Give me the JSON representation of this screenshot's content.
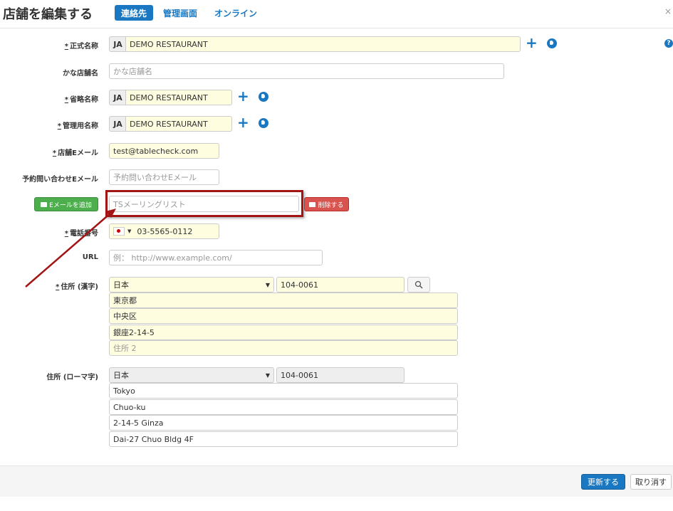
{
  "header": {
    "title": "店舗を編集する",
    "tabs": [
      {
        "label": "連絡先",
        "active": true
      },
      {
        "label": "管理画面",
        "active": false
      },
      {
        "label": "オンライン",
        "active": false
      }
    ],
    "close": "×"
  },
  "required_marker": "*",
  "fields": {
    "official_name": {
      "label": "正式名称",
      "lang": "JA",
      "value": "DEMO RESTAURANT"
    },
    "kana_name": {
      "label": "かな店舗名",
      "placeholder": "かな店舗名"
    },
    "short_name": {
      "label": "省略名称",
      "lang": "JA",
      "value": "DEMO RESTAURANT"
    },
    "admin_name": {
      "label": "管理用名称",
      "lang": "JA",
      "value": "DEMO RESTAURANT"
    },
    "shop_email": {
      "label": "店舗Eメール",
      "value": "test@tablecheck.com"
    },
    "inquiry_email": {
      "label": "予約問い合わせEメール",
      "placeholder": "予約問い合わせEメール"
    },
    "extra_email": {
      "add_button": "Eメールを追加",
      "placeholder": "TSメーリングリスト",
      "delete_button": "削除する"
    },
    "phone": {
      "label": "電話番号",
      "value": "03-5565-0112"
    },
    "url": {
      "label": "URL",
      "placeholder": "例： http://www.example.com/"
    },
    "address_kanji": {
      "label": "住所 (漢字)",
      "country": "日本",
      "postal": "104-0061",
      "lines": [
        "東京都",
        "中央区",
        "銀座2-14-5"
      ],
      "line4_placeholder": "住所 2"
    },
    "address_roman": {
      "label": "住所 (ローマ字)",
      "country": "日本",
      "postal": "104-0061",
      "lines": [
        "Tokyo",
        "Chuo-ku",
        "2-14-5 Ginza",
        "Dai-27 Chuo Bldg 4F"
      ]
    }
  },
  "footer": {
    "update_button": "更新する",
    "cancel_button": "取り消す"
  },
  "help_glyph": "?",
  "colors": {
    "accent": "#1a78c2",
    "highlight": "#a31515",
    "required_bg": "#fffde0"
  }
}
